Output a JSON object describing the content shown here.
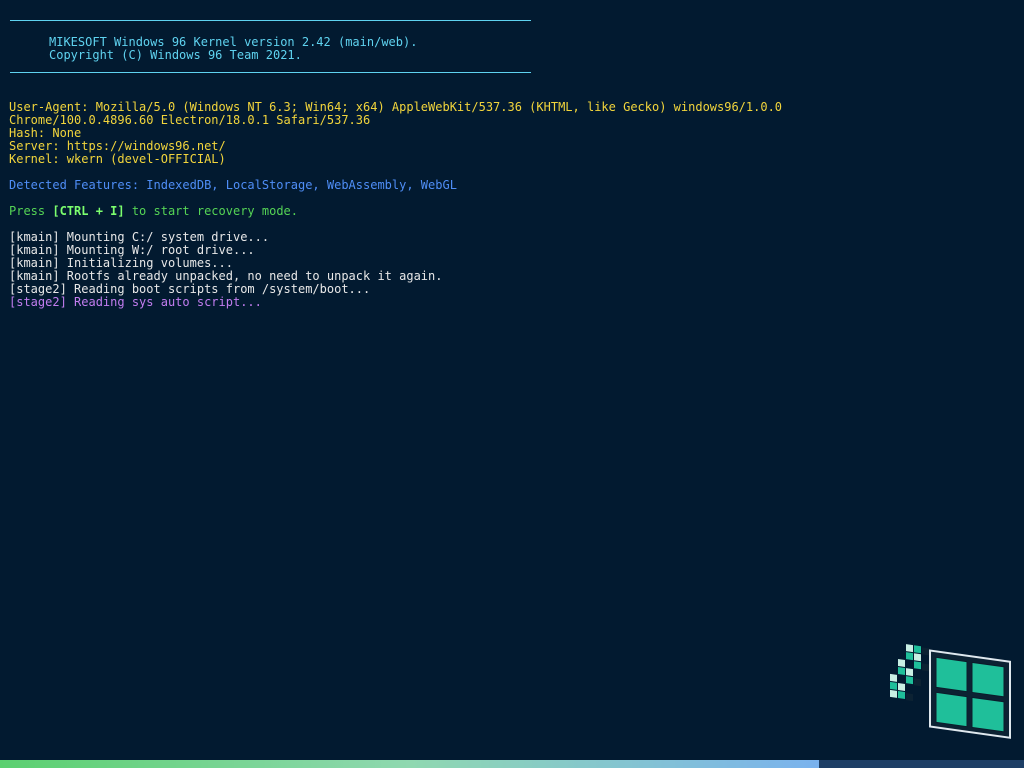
{
  "banner": {
    "line1": "MIKESOFT Windows 96 Kernel version 2.42 (main/web).",
    "line2": "Copyright (C) Windows 96 Team 2021."
  },
  "env": {
    "user_agent_1": "User-Agent: Mozilla/5.0 (Windows NT 6.3; Win64; x64) AppleWebKit/537.36 (KHTML, like Gecko) windows96/1.0.0",
    "user_agent_2": "Chrome/100.0.4896.60 Electron/18.0.1 Safari/537.36",
    "hash": "Hash: None",
    "server": "Server: https://windows96.net/",
    "kernel": "Kernel: wkern (devel-OFFICIAL)"
  },
  "features": "Detected Features: IndexedDB, LocalStorage, WebAssembly, WebGL",
  "recovery": {
    "prefix": "Press ",
    "key": "[CTRL + I]",
    "suffix": " to start recovery mode."
  },
  "log": [
    "[kmain] Mounting C:/ system drive...",
    "[kmain] Mounting W:/ root drive...",
    "[kmain] Initializing volumes...",
    "[kmain] Rootfs already unpacked, no need to unpack it again.",
    "[stage2] Reading boot scripts from /system/boot..."
  ],
  "current_step": "[stage2] Reading sys auto script...",
  "logo": {
    "icon": "windows96-flag-logo"
  },
  "progress": {
    "fraction": 0.8
  },
  "colors": {
    "background": "#021a30",
    "banner": "#5fd3f0",
    "env_text": "#f2d53c",
    "features_text": "#4f8ef7",
    "recovery_text": "#55d455",
    "log_text": "#e8e8e8",
    "current_step_text": "#c27df0",
    "logo_teal": "#1fbf9a"
  }
}
